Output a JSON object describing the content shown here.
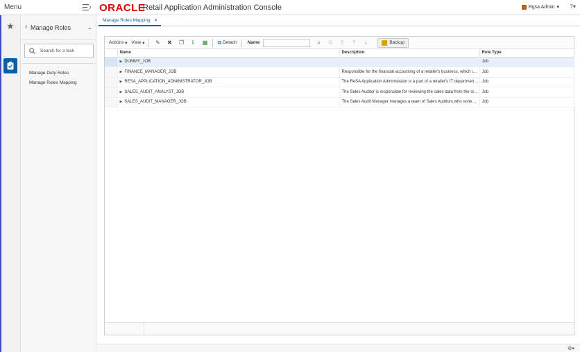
{
  "header": {
    "menu_label": "Menu",
    "brand": "ORACLE",
    "app_title": "Retail Application Administration Console",
    "user_name": "Rgsa Admin",
    "help": "?"
  },
  "rail": {
    "favorites_icon": "star-icon",
    "tasks_icon": "tasks-icon"
  },
  "task_panel": {
    "title": "Manage Roles",
    "search_placeholder": "Search for a task",
    "links": [
      "Manage Duty Roles",
      "Manage Roles Mapping"
    ]
  },
  "tabs": [
    {
      "label": "Manage Roles Mapping",
      "close": "×"
    }
  ],
  "toolbar": {
    "actions": "Actions",
    "view": "View",
    "detach": "Detach",
    "name_label": "Name",
    "name_value": "",
    "backup": "Backup"
  },
  "table": {
    "columns": [
      "Name",
      "Description",
      "Role Type"
    ],
    "rows": [
      {
        "name": "DUMMY_JOB",
        "description": "",
        "role_type": "Job"
      },
      {
        "name": "FINANCE_MANAGER_JOB",
        "description": "Responsible for the financial accounting of a retailer's business, which includes ...",
        "role_type": "Job"
      },
      {
        "name": "RESA_APPLICATION_ADMINISTRATOR_JOB",
        "description": "The ReSA Application Administrator is a part of a retailer's IT department respons...",
        "role_type": "Job"
      },
      {
        "name": "SALES_AUDIT_ANALYST_JOB",
        "description": "The Sales Auditor is responsible for reviewing the sales data from the stores that ...",
        "role_type": "Job"
      },
      {
        "name": "SALES_AUDIT_MANAGER_JOB",
        "description": "The Sales Audit Manager manages a team of Sales Auditors who review transact...",
        "role_type": "Job"
      }
    ]
  },
  "colors": {
    "brand": "#e10000",
    "accent": "#0a5fa5",
    "selected_row": "#e6effa"
  }
}
